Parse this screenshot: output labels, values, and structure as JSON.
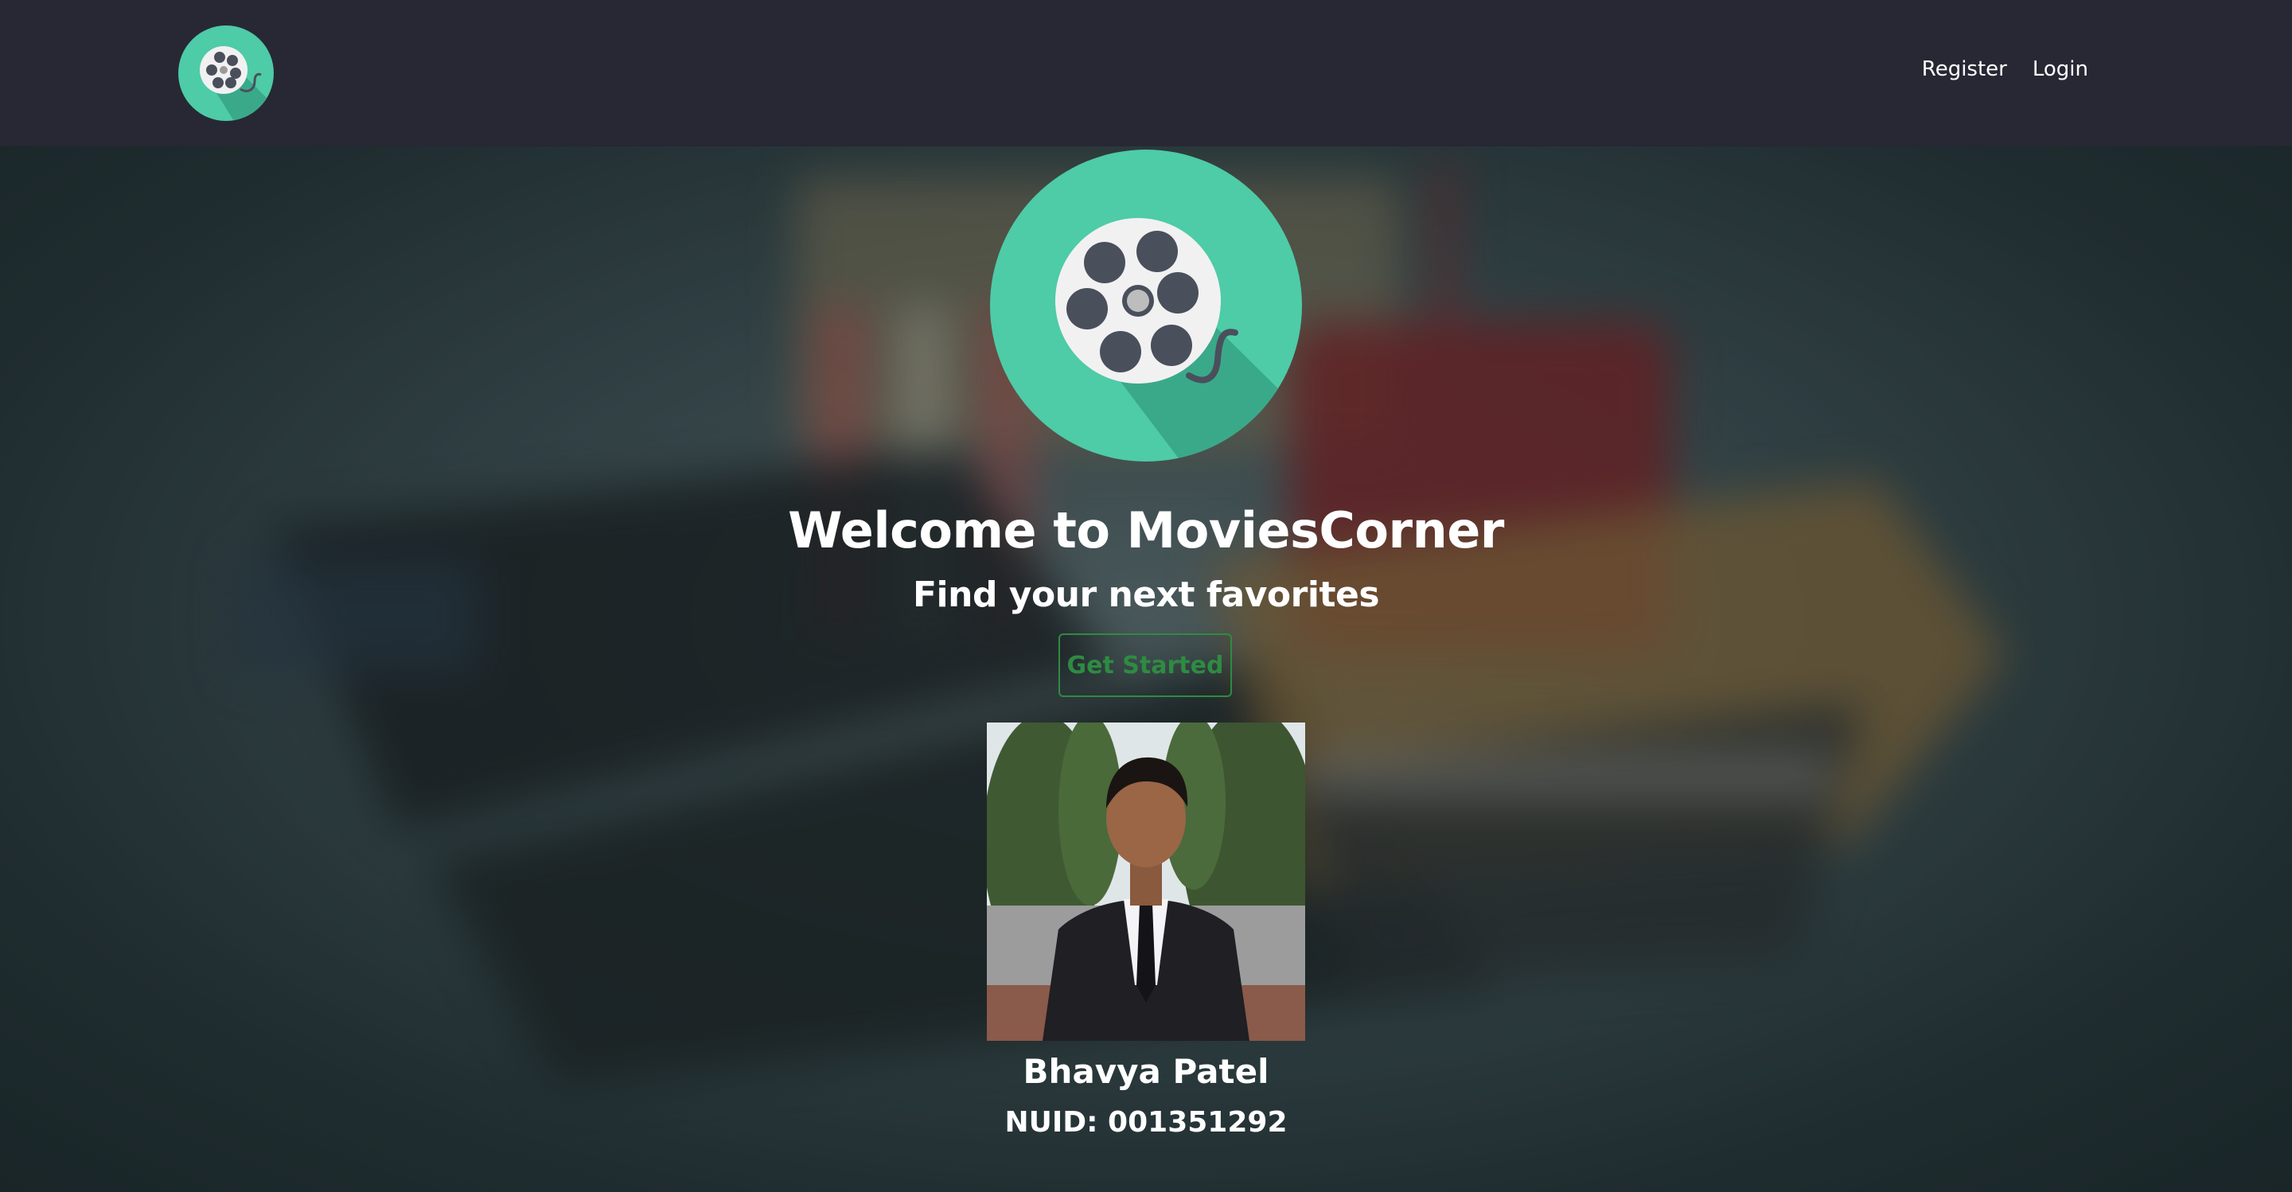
{
  "navbar": {
    "logo_icon": "film-reel-icon",
    "links": [
      {
        "label": "Register"
      },
      {
        "label": "Login"
      }
    ]
  },
  "hero": {
    "logo_icon": "film-reel-icon",
    "background_image": "blurred-cinema-clapperboard-popcorn",
    "title": "Welcome to MoviesCorner",
    "subtitle": "Find your next favorites",
    "cta_label": "Get Started"
  },
  "profile": {
    "photo": "student-portrait-photo",
    "name": "Bhavya Patel",
    "nuid": "NUID: 001351292"
  },
  "colors": {
    "navbar_bg": "#272834",
    "logo_teal": "#4ecba7",
    "cta_green": "#2e8b42",
    "text": "#ffffff"
  }
}
